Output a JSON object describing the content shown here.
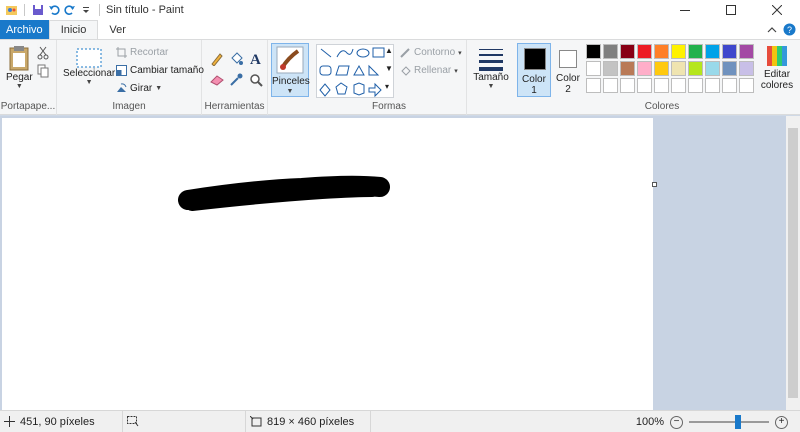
{
  "window": {
    "title": "Sin título - Paint"
  },
  "tabs": [
    {
      "label": "Archivo"
    },
    {
      "label": "Inicio"
    },
    {
      "label": "Ver"
    }
  ],
  "ribbon": {
    "portapapeles": {
      "group_label": "Portapape...",
      "paste_label": "Pegar"
    },
    "imagen": {
      "group_label": "Imagen",
      "select_label": "Seleccionar",
      "crop_label": "Recortar",
      "resize_label": "Cambiar tamaño",
      "rotate_label": "Girar"
    },
    "herramientas": {
      "group_label": "Herramientas"
    },
    "pinceles": {
      "label": "Pinceles"
    },
    "formas": {
      "group_label": "Formas",
      "outline_label": "Contorno",
      "fill_label": "Rellenar"
    },
    "tamano": {
      "label": "Tamaño"
    },
    "color1": {
      "label_line1": "Color",
      "label_line2": "1",
      "color": "#000000"
    },
    "color2": {
      "label_line1": "Color",
      "label_line2": "2",
      "color": "#ffffff"
    },
    "colores": {
      "group_label": "Colores",
      "edit_line1": "Editar",
      "edit_line2": "colores",
      "row1": [
        "#000000",
        "#7f7f7f",
        "#880015",
        "#ed1c24",
        "#ff7f27",
        "#fff200",
        "#22b14c",
        "#00a2e8",
        "#3f48cc",
        "#a349a4"
      ],
      "row2": [
        "#ffffff",
        "#c3c3c3",
        "#b97a57",
        "#ffaec9",
        "#ffc90e",
        "#efe4b0",
        "#b5e61d",
        "#99d9ea",
        "#7092be",
        "#c8bfe7"
      ],
      "row3": [
        "#ffffff",
        "#ffffff",
        "#ffffff",
        "#ffffff",
        "#ffffff",
        "#ffffff",
        "#ffffff",
        "#ffffff",
        "#ffffff",
        "#ffffff"
      ]
    }
  },
  "status": {
    "cursor_pos": "451, 90 píxeles",
    "image_size": "819 × 460 píxeles",
    "zoom": "100%"
  },
  "accent": "#1979ca"
}
